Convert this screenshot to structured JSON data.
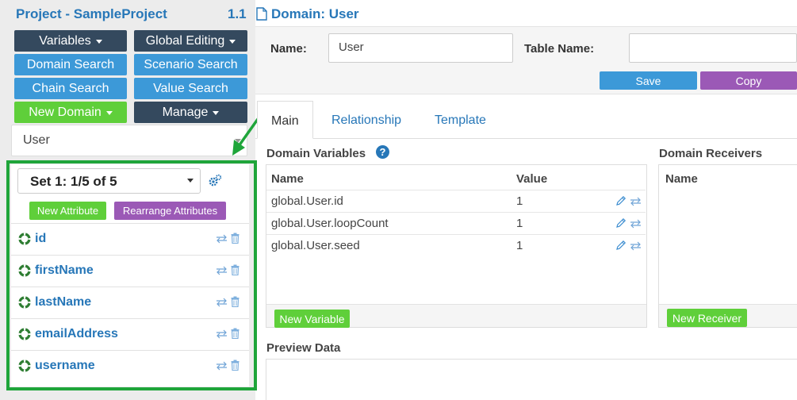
{
  "project": {
    "title": "Project - SampleProject",
    "version": "1.1"
  },
  "sidebar_buttons": {
    "variables": "Variables",
    "global_editing": "Global Editing",
    "domain_search": "Domain Search",
    "scenario_search": "Scenario Search",
    "chain_search": "Chain Search",
    "value_search": "Value Search",
    "new_domain": "New Domain",
    "manage": "Manage"
  },
  "domain_select": {
    "value": "User"
  },
  "attributes": {
    "set_label": "Set 1: 1/5 of 5",
    "new_attribute_label": "New Attribute",
    "rearrange_label": "Rearrange Attributes",
    "items": [
      {
        "label": "id"
      },
      {
        "label": "firstName"
      },
      {
        "label": "lastName"
      },
      {
        "label": "emailAddress"
      },
      {
        "label": "username"
      }
    ]
  },
  "domain": {
    "title": "Domain: User",
    "name_label": "Name:",
    "name_value": "User",
    "table_name_label": "Table Name:",
    "table_name_value": "",
    "save_label": "Save",
    "copy_label": "Copy"
  },
  "tabs": [
    {
      "label": "Main",
      "active": true
    },
    {
      "label": "Relationship",
      "active": false
    },
    {
      "label": "Template",
      "active": false
    }
  ],
  "domain_variables": {
    "title": "Domain Variables",
    "help_glyph": "?",
    "col_name": "Name",
    "col_value": "Value",
    "rows": [
      {
        "name": "global.User.id",
        "value": "1"
      },
      {
        "name": "global.User.loopCount",
        "value": "1"
      },
      {
        "name": "global.User.seed",
        "value": "1"
      }
    ],
    "new_variable_label": "New Variable"
  },
  "domain_receivers": {
    "title": "Domain Receivers",
    "col_name": "Name",
    "new_receiver_label": "New Receiver"
  },
  "preview": {
    "title": "Preview Data"
  },
  "colors": {
    "link_blue": "#2777b8",
    "dark_button": "#34495e",
    "blue_button": "#3c99d8",
    "green_button": "#5fcf3a",
    "purple_button": "#9b59b6",
    "annotation_green": "#1fa53a"
  }
}
